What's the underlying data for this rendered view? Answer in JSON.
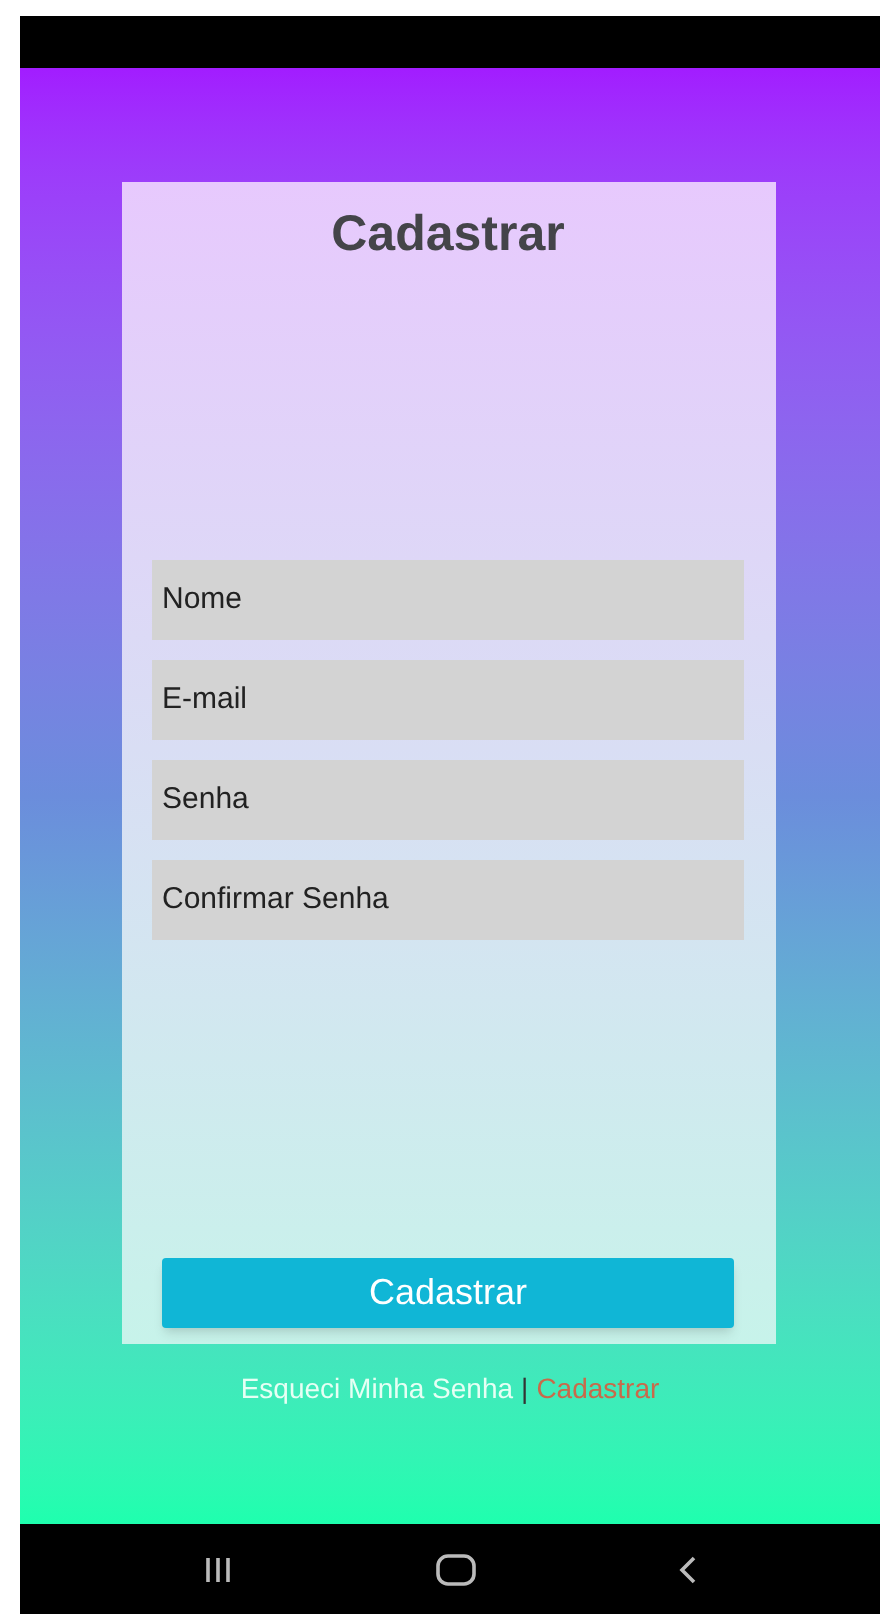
{
  "title": "Cadastrar",
  "fields": [
    {
      "placeholder": "Nome"
    },
    {
      "placeholder": "E-mail"
    },
    {
      "placeholder": "Senha"
    },
    {
      "placeholder": "Confirmar Senha"
    }
  ],
  "submit_button": "Cadastrar",
  "links": {
    "forgot": "Esqueci Minha Senha",
    "separator": "|",
    "register": "Cadastrar"
  }
}
